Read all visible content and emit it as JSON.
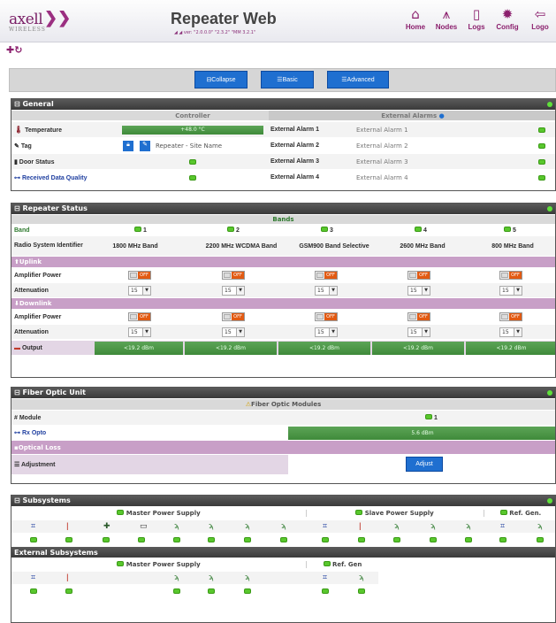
{
  "app": {
    "brand": "axell",
    "brand_sub": "WIRELESS",
    "title": "Repeater Web",
    "version_line": "◢ ◢ ver: \"2.0.0.0\" \"2.3.2\" \"MM 3.2.1\""
  },
  "nav": [
    {
      "label": "Home",
      "icon": "home-icon"
    },
    {
      "label": "Nodes",
      "icon": "nodes-icon"
    },
    {
      "label": "Logs",
      "icon": "logs-icon"
    },
    {
      "label": "Config",
      "icon": "gear-icon"
    },
    {
      "label": "Logo",
      "icon": "logout-icon"
    }
  ],
  "toolbar": {
    "collapse": "⊟Collapse",
    "basic": "☰Basic",
    "advanced": "☰Advanced"
  },
  "general": {
    "title": "⊟ General",
    "controller_header": "Controller",
    "alarms_header": "External Alarms",
    "temperature_label": "Temperature",
    "temperature_value": "+48.0 °C",
    "tag_label": "Tag",
    "tag_value": "Repeater - Site Name",
    "door_label": "Door Status",
    "rdq_label": "Received Data Quality",
    "alarms": [
      {
        "label": "External Alarm 1",
        "value": "External Alarm 1"
      },
      {
        "label": "External Alarm 2",
        "value": "External Alarm 2"
      },
      {
        "label": "External Alarm 3",
        "value": "External Alarm 3"
      },
      {
        "label": "External Alarm 4",
        "value": "External Alarm 4"
      }
    ]
  },
  "repeater": {
    "title": "⊟ Repeater Status",
    "bands_header": "Bands",
    "band_label": "Band",
    "rsi_label": "Radio System Identifier",
    "bands": [
      {
        "num": "1",
        "name": "1800 MHz Band"
      },
      {
        "num": "2",
        "name": "2200 MHz WCDMA Band"
      },
      {
        "num": "3",
        "name": "GSM900 Band Selective"
      },
      {
        "num": "4",
        "name": "2600 MHz Band"
      },
      {
        "num": "5",
        "name": "800 MHz Band"
      }
    ],
    "uplink": "Uplink",
    "downlink": "Downlink",
    "amp_label": "Amplifier Power",
    "att_label": "Attenuation",
    "out_label": "Output",
    "switch_text": "OFF",
    "att_value": "15",
    "output_value": "<19.2 dBm"
  },
  "fiber": {
    "title": "⊟ Fiber Optic Unit",
    "modules_header": "Fiber Optic Modules",
    "module_label": "Module",
    "module_num": "1",
    "rx_label": "Rx Opto",
    "rx_value": "5.6 dBm",
    "loss_label": "Optical Loss",
    "adj_label": "Adjustment",
    "adj_btn": "Adjust"
  },
  "subsystems": {
    "title": "⊟ Subsystems",
    "master": "Master Power Supply",
    "slave": "Slave Power Supply",
    "ref": "Ref. Gen.",
    "ext_title": "External Subsystems",
    "ext_master": "Master Power Supply",
    "ext_ref": "Ref. Gen"
  },
  "colors": {
    "accent": "#8b1f6d",
    "ok": "#59c72d",
    "button": "#1f6fd0",
    "uplink_bg": "#c89fc7"
  }
}
